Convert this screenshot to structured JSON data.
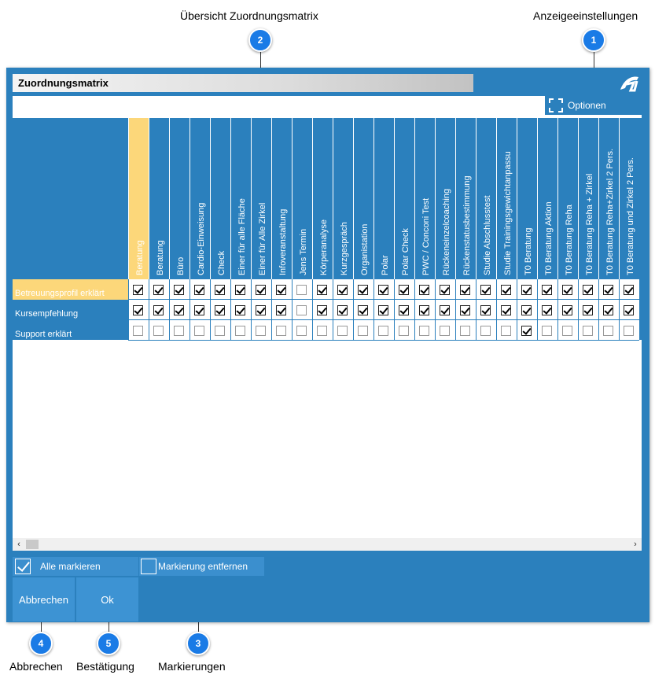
{
  "annotations": {
    "matrix_overview": "Übersicht Zuordnungsmatrix",
    "display_settings": "Anzeigeeinstellungen",
    "cancel": "Abbrechen",
    "confirm": "Bestätigung",
    "markings": "Markierungen",
    "callouts": [
      "1",
      "2",
      "3",
      "4",
      "5"
    ]
  },
  "window": {
    "title": "Zuordnungsmatrix",
    "logo_icon": "app-logo-icon"
  },
  "toolbar": {
    "options_label": "Optionen",
    "options_icon": "expand-frame-icon"
  },
  "matrix": {
    "columns": [
      "Beratung",
      "Beratung",
      "Büro",
      "Cardio-Einweisung",
      "Check",
      "Einer für alle Fläche",
      "Einer für Alle Zirkel",
      "Infoveranstaltung",
      "Jens Termin",
      "Körperanalyse",
      "Kurzgespräch",
      "Organistation",
      "Polar",
      "Polar Check",
      "PWC / Conconi Test",
      "Rückeneinzelcoaching",
      "Rückenstatusbestimmung",
      "Studie Abschlusstest",
      "Studie Trainingsgewichtanpassu",
      "T0 Beratung",
      "T0 Beratung Aktion",
      "T0 Beratung Reha",
      "T0 Beratung Reha + Zirkel",
      "T0 Beratung Reha+Zirkel 2 Pers.",
      "T0 Beratung und Zirkel 2 Pers."
    ],
    "selected_column": 0,
    "rows": [
      {
        "label": "Betreuungsprofil erklärt",
        "selected": true,
        "checks": [
          true,
          true,
          true,
          true,
          true,
          true,
          true,
          true,
          false,
          true,
          true,
          true,
          true,
          true,
          true,
          true,
          true,
          true,
          true,
          true,
          true,
          true,
          true,
          true,
          true
        ]
      },
      {
        "label": "Kursempfehlung",
        "selected": false,
        "checks": [
          true,
          true,
          true,
          true,
          true,
          true,
          true,
          true,
          false,
          true,
          true,
          true,
          true,
          true,
          true,
          true,
          true,
          true,
          true,
          true,
          true,
          true,
          true,
          true,
          true
        ]
      },
      {
        "label": "Support erklärt",
        "selected": false,
        "checks": [
          false,
          false,
          false,
          false,
          false,
          false,
          false,
          false,
          false,
          false,
          false,
          false,
          false,
          false,
          false,
          false,
          false,
          false,
          false,
          true,
          false,
          false,
          false,
          false,
          false
        ]
      }
    ]
  },
  "scrollbar": {
    "left_arrow": "‹",
    "right_arrow": "›"
  },
  "mark_actions": {
    "mark_all": "Alle markieren",
    "remove_marks": "Markierung entfernen"
  },
  "buttons": {
    "cancel": "Abbrechen",
    "ok": "Ok"
  },
  "colors": {
    "window_blue": "#2b80bd",
    "selection_yellow": "#fcd77a",
    "callout_blue": "#1a7be6"
  }
}
